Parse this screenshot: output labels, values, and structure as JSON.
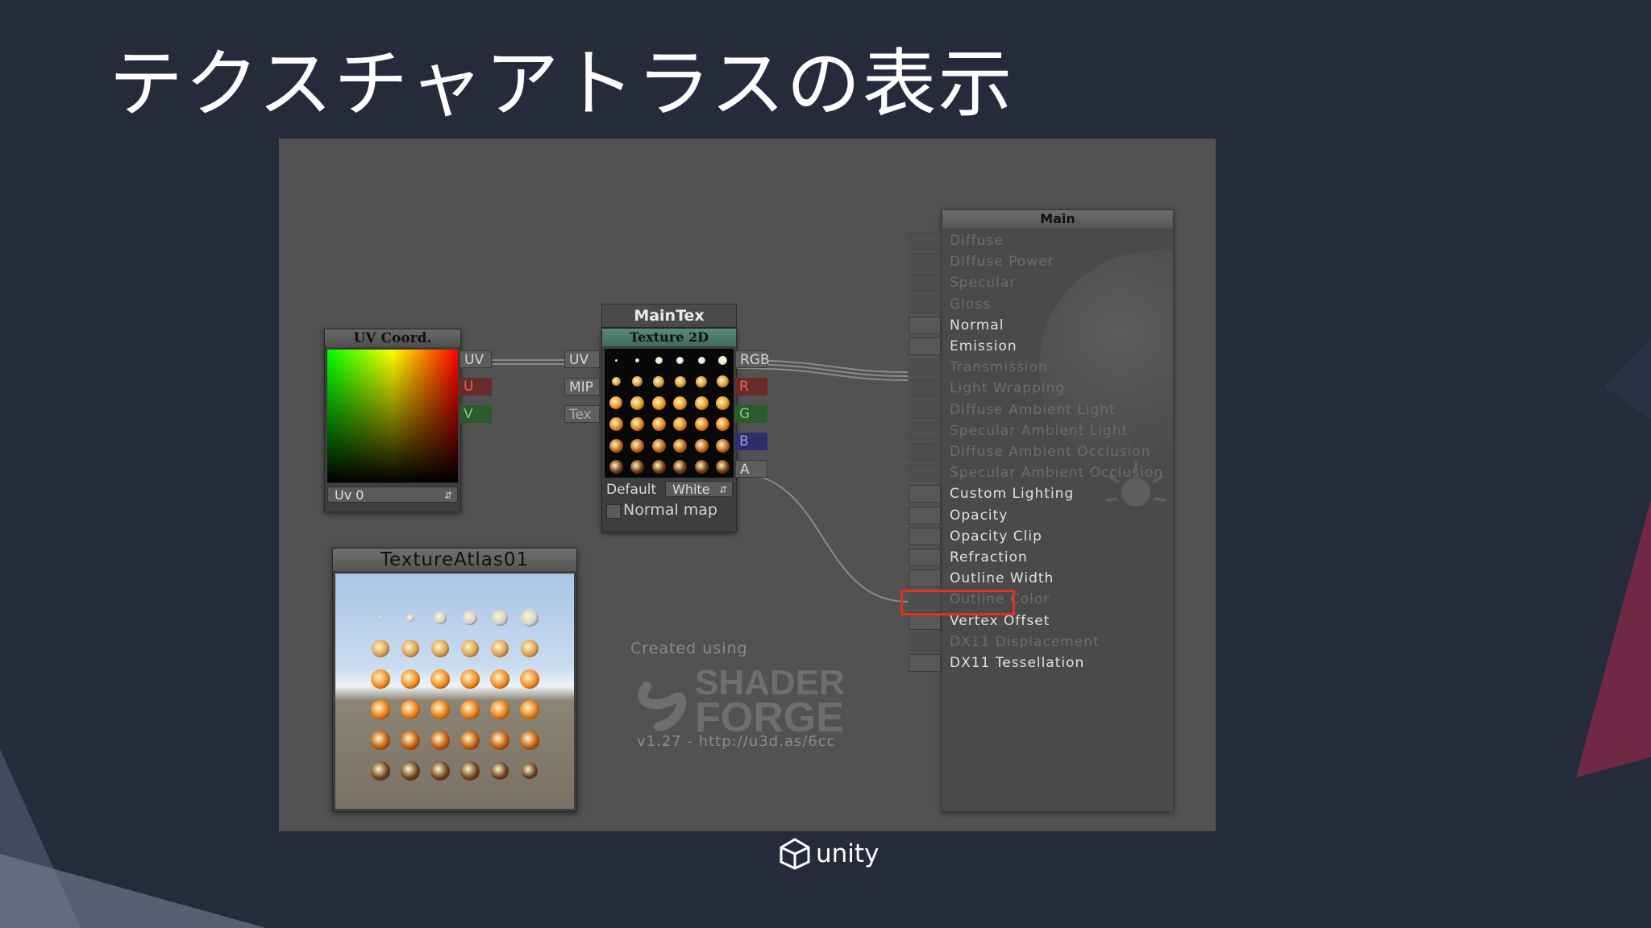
{
  "slide": {
    "title": "テクスチャアトラスの表示"
  },
  "uv_node": {
    "header": "UV Coord.",
    "dropdown_value": "Uv 0",
    "outputs": [
      "UV",
      "U",
      "V"
    ]
  },
  "maintex_node": {
    "title": "MainTex",
    "header": "Texture 2D",
    "inputs": [
      "UV",
      "MIP",
      "Tex"
    ],
    "outputs": [
      "RGB",
      "R",
      "G",
      "B",
      "A"
    ],
    "default_label": "Default",
    "default_value": "White",
    "normal_map_label": "Normal map"
  },
  "atlas_node": {
    "header": "TextureAtlas01"
  },
  "watermark": {
    "created_using": "Created using",
    "logo_line1": "SHADER",
    "logo_line2": "FORGE",
    "version": "v1.27 - http://u3d.as/6cc"
  },
  "main_node": {
    "header": "Main",
    "inputs": [
      {
        "label": "Diffuse",
        "active": false
      },
      {
        "label": "Diffuse Power",
        "active": false
      },
      {
        "label": "Specular",
        "active": false
      },
      {
        "label": "Gloss",
        "active": false
      },
      {
        "label": "Normal",
        "active": true
      },
      {
        "label": "Emission",
        "active": true
      },
      {
        "label": "Transmission",
        "active": false
      },
      {
        "label": "Light Wrapping",
        "active": false
      },
      {
        "label": "Diffuse Ambient Light",
        "active": false
      },
      {
        "label": "Specular Ambient Light",
        "active": false
      },
      {
        "label": "Diffuse Ambient Occlusion",
        "active": false
      },
      {
        "label": "Specular Ambient Occlusion",
        "active": false
      },
      {
        "label": "Custom Lighting",
        "active": true
      },
      {
        "label": "Opacity",
        "active": true,
        "highlighted": true
      },
      {
        "label": "Opacity Clip",
        "active": true
      },
      {
        "label": "Refraction",
        "active": true
      },
      {
        "label": "Outline Width",
        "active": true
      },
      {
        "label": "Outline Color",
        "active": false
      },
      {
        "label": "Vertex Offset",
        "active": true
      },
      {
        "label": "DX11 Displacement",
        "active": false
      },
      {
        "label": "DX11 Tessellation",
        "active": true
      }
    ]
  },
  "footer": {
    "brand": "unity"
  },
  "colors": {
    "slide_bg": "#252b3b",
    "highlight": "#e2311d",
    "editor_bg": "#525252"
  }
}
